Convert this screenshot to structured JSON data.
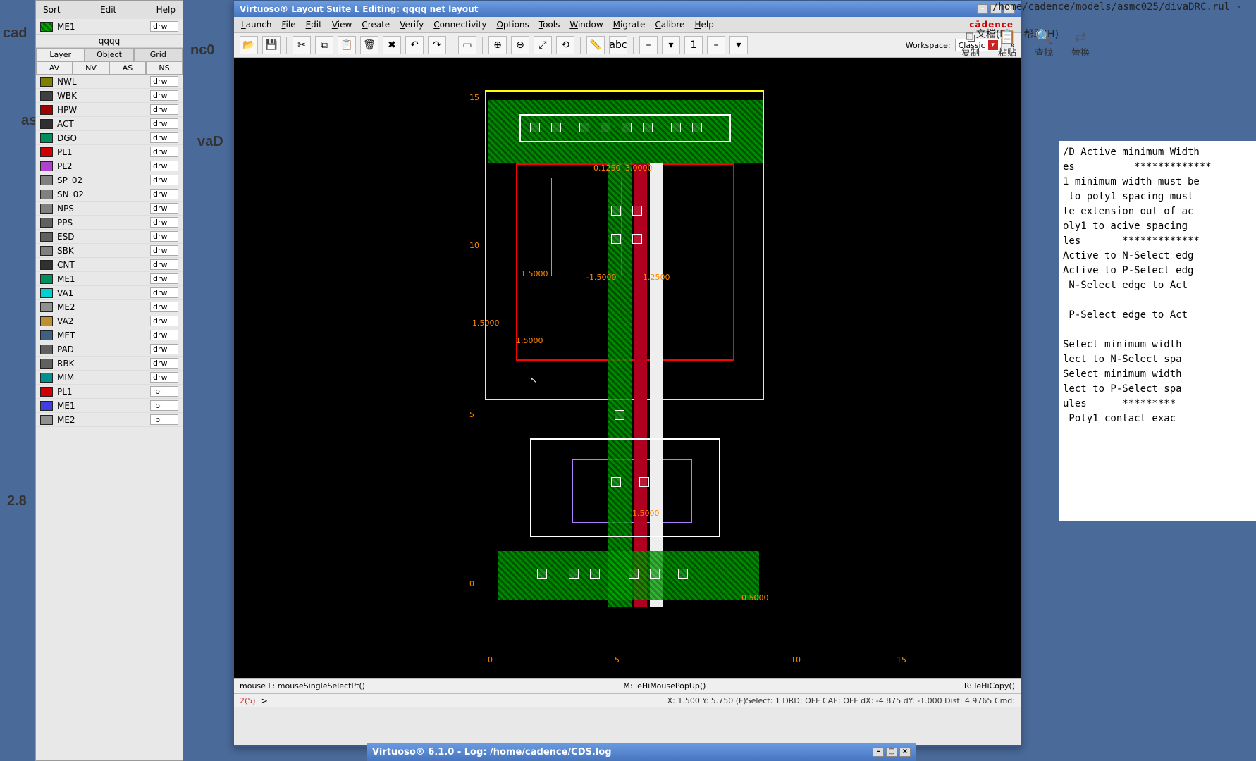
{
  "bg": {
    "cad": "cad",
    "nc0": "nc0",
    "as": "as",
    "vaD": "vaD",
    "num28": "2.8"
  },
  "layers_menu": {
    "sort": "Sort",
    "edit": "Edit",
    "help": "Help"
  },
  "active_layer": {
    "name": "ME1",
    "purpose": "drw"
  },
  "design_label": "qqqq",
  "tabs": {
    "layer": "Layer",
    "object": "Object",
    "grid": "Grid"
  },
  "filters": {
    "av": "AV",
    "nv": "NV",
    "as": "AS",
    "ns": "NS"
  },
  "layers": [
    {
      "name": "NWL",
      "purpose": "drw",
      "color": "#808000"
    },
    {
      "name": "WBK",
      "purpose": "drw",
      "color": "#404040"
    },
    {
      "name": "HPW",
      "purpose": "drw",
      "color": "#a00000"
    },
    {
      "name": "ACT",
      "purpose": "drw",
      "color": "#303030"
    },
    {
      "name": "DGO",
      "purpose": "drw",
      "color": "#009060"
    },
    {
      "name": "PL1",
      "purpose": "drw",
      "color": "#d00000"
    },
    {
      "name": "PL2",
      "purpose": "drw",
      "color": "#b040d0"
    },
    {
      "name": "SP_02",
      "purpose": "drw",
      "color": "#808080"
    },
    {
      "name": "SN_02",
      "purpose": "drw",
      "color": "#808080"
    },
    {
      "name": "NPS",
      "purpose": "drw",
      "color": "#808080"
    },
    {
      "name": "PPS",
      "purpose": "drw",
      "color": "#606060"
    },
    {
      "name": "ESD",
      "purpose": "drw",
      "color": "#606060"
    },
    {
      "name": "SBK",
      "purpose": "drw",
      "color": "#808080"
    },
    {
      "name": "CNT",
      "purpose": "drw",
      "color": "#303030"
    },
    {
      "name": "ME1",
      "purpose": "drw",
      "color": "#009060"
    },
    {
      "name": "VA1",
      "purpose": "drw",
      "color": "#00d0d0"
    },
    {
      "name": "ME2",
      "purpose": "drw",
      "color": "#909090"
    },
    {
      "name": "VA2",
      "purpose": "drw",
      "color": "#c09030"
    },
    {
      "name": "MET",
      "purpose": "drw",
      "color": "#406080"
    },
    {
      "name": "PAD",
      "purpose": "drw",
      "color": "#606060"
    },
    {
      "name": "RBK",
      "purpose": "drw",
      "color": "#606060"
    },
    {
      "name": "MIM",
      "purpose": "drw",
      "color": "#009090"
    },
    {
      "name": "PL1",
      "purpose": "lbl",
      "color": "#d00000"
    },
    {
      "name": "ME1",
      "purpose": "lbl",
      "color": "#4040e0"
    },
    {
      "name": "ME2",
      "purpose": "lbl",
      "color": "#909090"
    }
  ],
  "window": {
    "title": "Virtuoso® Layout Suite L Editing: qqqq net layout",
    "brand": "cādence"
  },
  "menu": [
    "Launch",
    "File",
    "Edit",
    "View",
    "Create",
    "Verify",
    "Connectivity",
    "Options",
    "Tools",
    "Window",
    "Migrate",
    "Calibre",
    "Help"
  ],
  "toolbar_icons": [
    "open",
    "save",
    "|",
    "cut",
    "copy",
    "paste",
    "del",
    "x",
    "undo",
    "redo",
    "|",
    "sel",
    "|",
    "zoom-in",
    "zoom-out",
    "zoom-fit",
    "zoom-prev",
    "|",
    "ruler",
    "abc",
    "|",
    "-",
    "drop",
    "1",
    "-",
    "drop2"
  ],
  "workspace": {
    "label": "Workspace:",
    "value": "Classic"
  },
  "ruler_y": [
    "15",
    "10",
    "5",
    "0"
  ],
  "ruler_x": [
    "0",
    "5",
    "10",
    "15"
  ],
  "dims": {
    "d1": "0.1250",
    "d2": "3.0000",
    "d3": "1.5000",
    "d4": "-1.5000",
    "d5": "1.2500",
    "d6": "1.5000",
    "d7": "1.5000",
    "d8": "1.5000",
    "d9": "0.5000"
  },
  "status": {
    "left": "mouse L: mouseSingleSelectPt()",
    "mid": "M: leHiMousePopUp()",
    "right": "R: leHiCopy()"
  },
  "cmd": {
    "count": "2(5)",
    "prompt": ">",
    "info": "X: 1.500   Y: 5.750   (F)Select: 1   DRD: OFF   CAE: OFF   dX: -4.875   dY: -1.000   Dist: 4.9765   Cmd:"
  },
  "right_path": "/home/cadence/models/asmc025/divaDRC.rul -",
  "right_menu_cn": [
    "文檔(D)",
    "帮助(H)"
  ],
  "right_btns_cn": [
    "复制",
    "粘贴",
    "查找",
    "替换"
  ],
  "drc_lines": [
    "/D Active minimum Width",
    "es          *************",
    "1 minimum width must be",
    " to poly1 spacing must ",
    "te extension out of ac",
    "oly1 to acive spacing ",
    "les       *************",
    "Active to N-Select edg",
    "Active to P-Select edg",
    " N-Select edge to Act",
    "",
    " P-Select edge to Act",
    "",
    "Select minimum width",
    "lect to N-Select spa",
    "Select minimum width",
    "lect to P-Select spa",
    "ules      *********",
    " Poly1 contact exac"
  ],
  "ciw_title": "Virtuoso® 6.1.0 - Log: /home/cadence/CDS.log"
}
